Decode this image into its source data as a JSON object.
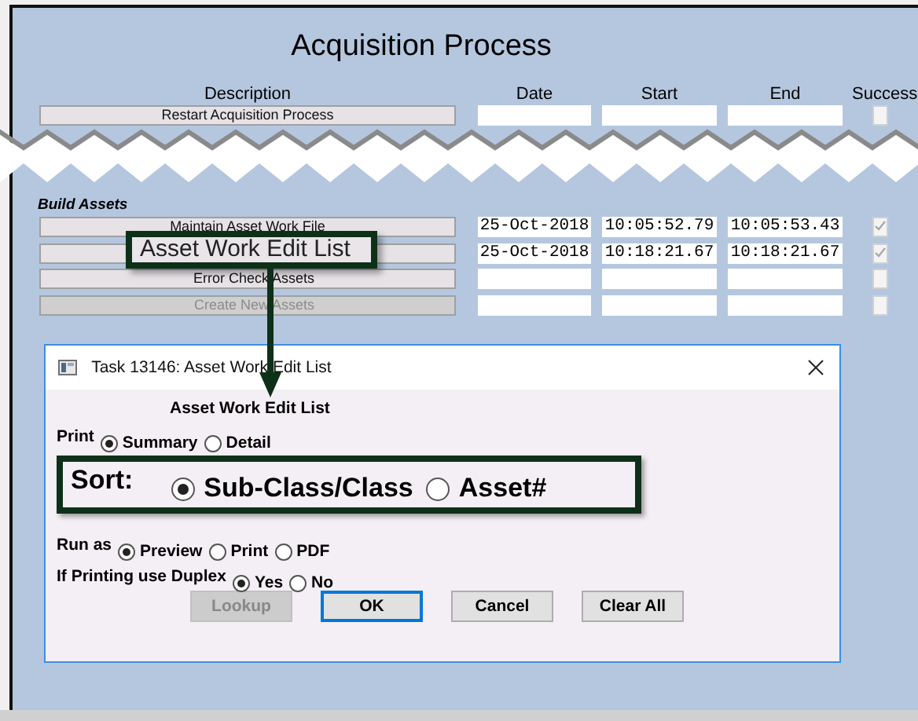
{
  "title": "Acquisition Process",
  "columns": [
    "Description",
    "Date",
    "Start",
    "End",
    "Success"
  ],
  "top_rows": [
    {
      "label": "Restart Acquisition Process",
      "checked": false
    }
  ],
  "section": "Build Assets",
  "rows": [
    {
      "label": "Maintain Asset Work File",
      "date": "25-Oct-2018",
      "start": "10:05:52.79",
      "end": "10:05:53.43",
      "checked": true,
      "disabled": false
    },
    {
      "date": "25-Oct-2018",
      "start": "10:18:21.67",
      "end": "10:18:21.67",
      "checked": true,
      "disabled": false
    },
    {
      "label": "Error Check Assets",
      "checked": false,
      "disabled": false
    },
    {
      "label": "Create New Assets",
      "checked": false,
      "disabled": true
    }
  ],
  "callout": {
    "text": "Asset Work Edit List"
  },
  "dialog": {
    "title": "Task 13146: Asset Work Edit List",
    "heading": "Asset Work Edit List",
    "groups": [
      {
        "label": "Print",
        "kind": "plain",
        "options": [
          {
            "label": "Summary",
            "selected": true
          },
          {
            "label": "Detail",
            "selected": false
          }
        ]
      },
      {
        "label": "Sort:",
        "kind": "highlighted",
        "options": [
          {
            "label": "Sub-Class/Class",
            "selected": true
          },
          {
            "label": "Asset#",
            "selected": false
          }
        ]
      },
      {
        "label": "Run as",
        "kind": "plain",
        "options": [
          {
            "label": "Preview",
            "selected": true
          },
          {
            "label": "Print",
            "selected": false
          },
          {
            "label": "PDF",
            "selected": false
          }
        ]
      },
      {
        "label": "If Printing use Duplex",
        "kind": "plain",
        "options": [
          {
            "label": "Yes",
            "selected": true
          },
          {
            "label": "No",
            "selected": false
          }
        ]
      }
    ],
    "buttons": [
      {
        "label": "Lookup",
        "disabled": true,
        "focused": false
      },
      {
        "label": "OK",
        "disabled": false,
        "focused": true
      },
      {
        "label": "Cancel",
        "disabled": false,
        "focused": false
      },
      {
        "label": "Clear All",
        "disabled": false,
        "focused": false
      }
    ]
  }
}
